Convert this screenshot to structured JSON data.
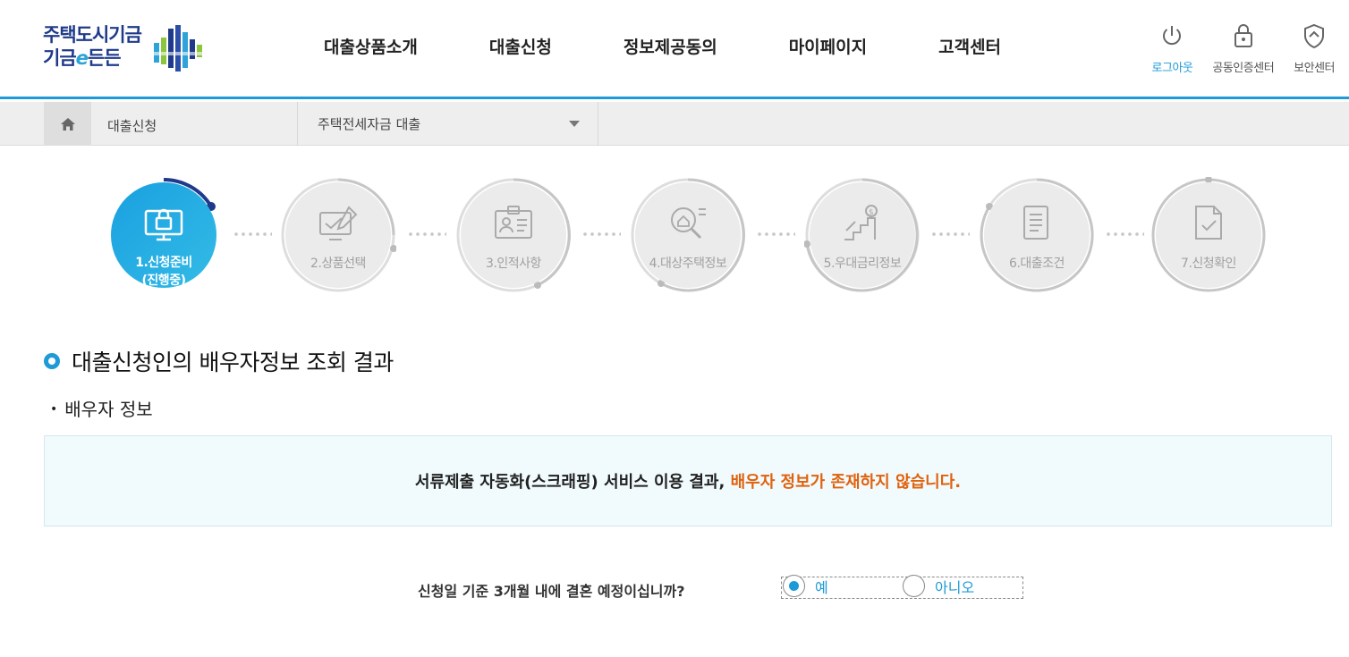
{
  "header": {
    "logo": {
      "line1": "주택도시기금",
      "line2_a": "기금",
      "line2_e": "e",
      "line2_b": "든든"
    },
    "gnb": [
      "대출상품소개",
      "대출신청",
      "정보제공동의",
      "마이페이지",
      "고객센터"
    ],
    "util": [
      {
        "label": "로그아웃",
        "icon": "power-icon"
      },
      {
        "label": "공동인증센터",
        "icon": "lock-icon"
      },
      {
        "label": "보안센터",
        "icon": "shield-icon"
      }
    ]
  },
  "breadcrumb": {
    "current": "대출신청",
    "select_label": "주택전세자금 대출"
  },
  "steps": [
    {
      "label": "1.신청준비",
      "sub": "(진행중)",
      "icon": "computer-lock-icon",
      "active": true
    },
    {
      "label": "2.상품선택",
      "icon": "monitor-check-icon"
    },
    {
      "label": "3.인적사항",
      "icon": "id-card-icon"
    },
    {
      "label": "4.대상주택정보",
      "icon": "search-house-icon"
    },
    {
      "label": "5.우대금리정보",
      "icon": "money-stairs-icon"
    },
    {
      "label": "6.대출조건",
      "icon": "document-icon"
    },
    {
      "label": "7.신청확인",
      "icon": "document-check-icon"
    }
  ],
  "section": {
    "title": "대출신청인의 배우자정보 조회 결과",
    "subtitle": "배우자 정보"
  },
  "notice": {
    "text": "서류제출 자동화(스크래핑) 서비스 이용 결과,",
    "alert": "배우자 정보가 존재하지 않습니다."
  },
  "question": {
    "text": "신청일 기준 3개월 내에 결혼 예정이십니까?",
    "options": [
      "예",
      "아니오"
    ],
    "selected": "예"
  },
  "colors": {
    "accent": "#1e9ad6",
    "alert": "#e0620e",
    "brand": "#1f3a8a"
  }
}
